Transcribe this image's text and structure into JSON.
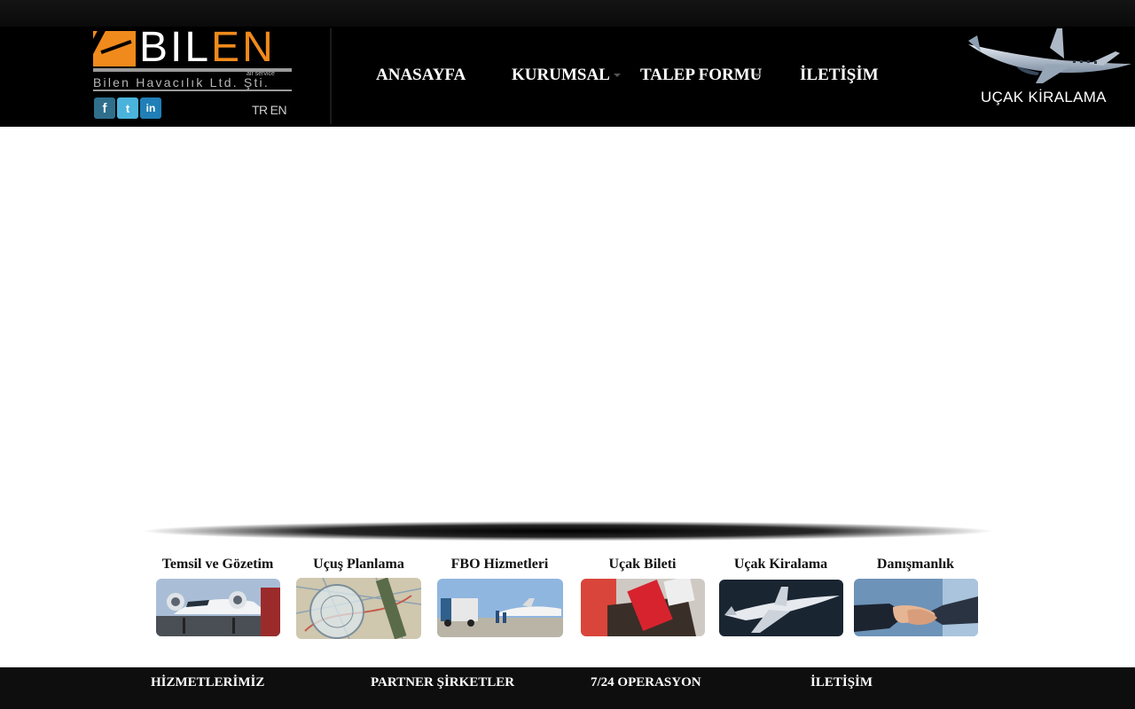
{
  "brand": {
    "word_white": "BIL",
    "word_orange": "EN",
    "air_service": "air service",
    "company": "Bilen Havacılık Ltd. Şti."
  },
  "social": {
    "facebook": "f",
    "twitter": "t",
    "linkedin": "in"
  },
  "language": {
    "tr": "TR",
    "en": "EN"
  },
  "nav": {
    "items": [
      {
        "label": "ANASAYFA",
        "has_submenu": false
      },
      {
        "label": "KURUMSAL",
        "has_submenu": true
      },
      {
        "label": "TALEP FORMU",
        "has_submenu": true
      },
      {
        "label": "İLETİŞİM",
        "has_submenu": false
      }
    ]
  },
  "banner": {
    "label": "UÇAK KİRALAMA"
  },
  "services": [
    {
      "title": "Temsil ve Gözetim"
    },
    {
      "title": "Uçuş Planlama"
    },
    {
      "title": "FBO Hizmetleri"
    },
    {
      "title": "Uçak Bileti"
    },
    {
      "title": "Uçak Kiralama"
    },
    {
      "title": "Danışmanlık"
    }
  ],
  "footer": {
    "items": [
      {
        "label": "HİZMETLERİMİZ"
      },
      {
        "label": "PARTNER ŞİRKETLER"
      },
      {
        "label": "7/24 OPERASYON"
      },
      {
        "label": "İLETİŞİM"
      }
    ]
  },
  "colors": {
    "brand_orange": "#f08a1c",
    "header_bg": "#000000",
    "footer_bg": "#0e0e0e",
    "logo_gray": "#9a9a9a"
  },
  "icons": {
    "nav_caret": "caret-down-icon",
    "banner_plane": "jet-plane-icon"
  }
}
